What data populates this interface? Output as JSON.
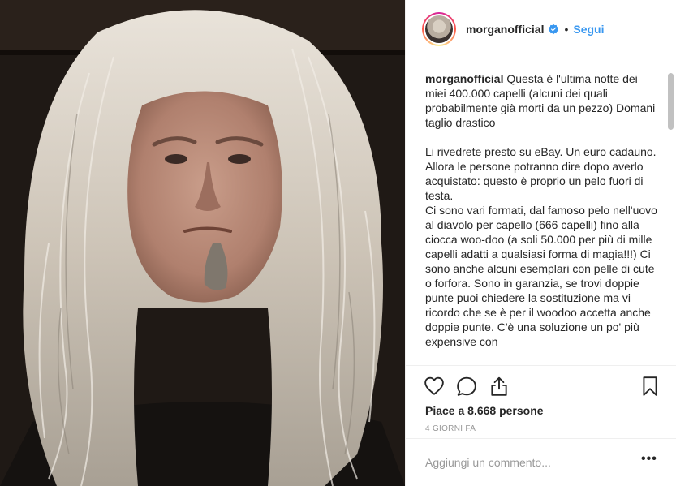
{
  "post": {
    "photo_alt": "selfie",
    "header": {
      "username": "morganofficial",
      "separator": "•",
      "follow_label": "Segui"
    },
    "caption": {
      "username": "morganofficial",
      "paragraph1": "Questa è l'ultima notte dei miei 400.000 capelli (alcuni dei quali probabilmente già morti da un pezzo) Domani taglio drastico",
      "paragraph2": "Li rivedrete presto su eBay. Un euro cadauno. Allora le persone potranno dire dopo averlo acquistato: questo è proprio un pelo fuori di testa.",
      "paragraph3": "Ci sono vari formati, dal famoso pelo nell'uovo al diavolo per capello (666 capelli) fino alla ciocca woo-doo (a soli 50.000 per più di mille capelli adatti a qualsiasi forma di magia!!!) Ci sono anche alcuni esemplari con pelle di cute o forfora. Sono in garanzia, se trovi doppie punte puoi chiedere la sostituzione ma vi ricordo che se è per il woodoo accetta anche doppie punte. C'è una soluzione un po' più expensive con"
    },
    "likes_text": "Piace a 8.668 persone",
    "timestamp": "4 GIORNI FA",
    "comment": {
      "placeholder": "Aggiungi un commento...",
      "more_label": "•••"
    },
    "icons": {
      "like": "heart-icon",
      "comment": "comment-bubble-icon",
      "share": "share-icon",
      "save": "bookmark-icon",
      "verified": "verified-badge-icon"
    },
    "colors": {
      "follow": "#3897f0",
      "verified": "#3897f0",
      "text": "#262626",
      "muted": "#999999"
    }
  }
}
